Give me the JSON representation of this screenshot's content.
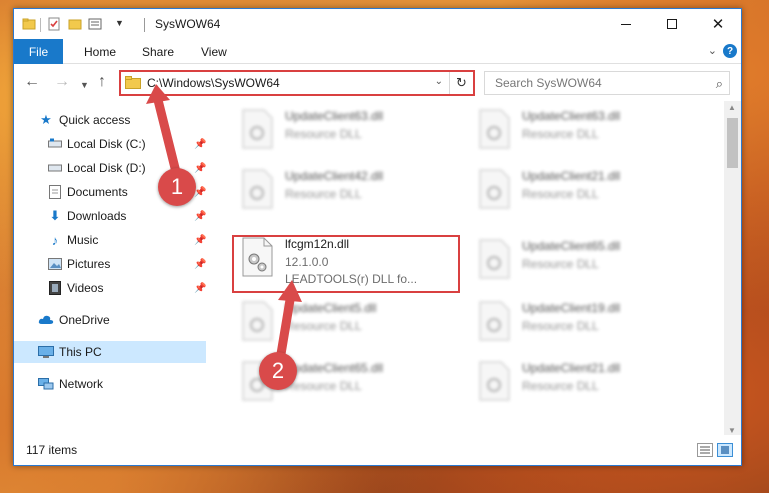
{
  "window": {
    "title": "SysWOW64"
  },
  "ribbon": {
    "tabs": [
      {
        "label": "File"
      },
      {
        "label": "Home"
      },
      {
        "label": "Share"
      },
      {
        "label": "View"
      }
    ],
    "help": "?"
  },
  "address_bar": {
    "path": "C:\\Windows\\SysWOW64"
  },
  "search": {
    "placeholder": "Search SysWOW64"
  },
  "sidebar": {
    "items": [
      {
        "label": "Quick access",
        "icon": "star-icon"
      },
      {
        "label": "Local Disk (C:)",
        "icon": "drive-icon",
        "pinned": true
      },
      {
        "label": "Local Disk (D:)",
        "icon": "drive-icon",
        "pinned": true
      },
      {
        "label": "Documents",
        "icon": "documents-icon",
        "pinned": true
      },
      {
        "label": "Downloads",
        "icon": "downloads-icon",
        "pinned": true
      },
      {
        "label": "Music",
        "icon": "music-icon",
        "pinned": true
      },
      {
        "label": "Pictures",
        "icon": "pictures-icon",
        "pinned": true
      },
      {
        "label": "Videos",
        "icon": "videos-icon",
        "pinned": true
      },
      {
        "label": "OneDrive",
        "icon": "cloud-icon"
      },
      {
        "label": "This PC",
        "icon": "computer-icon",
        "selected": true
      },
      {
        "label": "Network",
        "icon": "network-icon"
      }
    ]
  },
  "files": {
    "left": [
      {
        "name": "UpdateClient63.dll",
        "type": "Resource DLL"
      },
      {
        "name": "UpdateClient42.dll",
        "type": "Resource DLL"
      },
      {
        "name": "lfcgm12n.dll",
        "version": "12.1.0.0",
        "type": "LEADTOOLS(r) DLL fo..."
      },
      {
        "name": "UpdateClient5.dll",
        "type": "Resource DLL"
      },
      {
        "name": "UpdateClient65.dll",
        "type": "Resource DLL"
      }
    ],
    "right": [
      {
        "name": "UpdateClient63.dll",
        "type": "Resource DLL"
      },
      {
        "name": "UpdateClient21.dll",
        "type": "Resource DLL"
      },
      {
        "name": "UpdateClient65.dll",
        "type": "Resource DLL"
      },
      {
        "name": "UpdateClient19.dll",
        "type": "Resource DLL"
      },
      {
        "name": "UpdateClient21.dll",
        "type": "Resource DLL"
      }
    ]
  },
  "status": {
    "item_count": "117 items"
  },
  "callouts": {
    "one": "1",
    "two": "2"
  },
  "colors": {
    "accent": "#1979ca",
    "highlight": "#d94040",
    "callout": "#d94a4a"
  }
}
